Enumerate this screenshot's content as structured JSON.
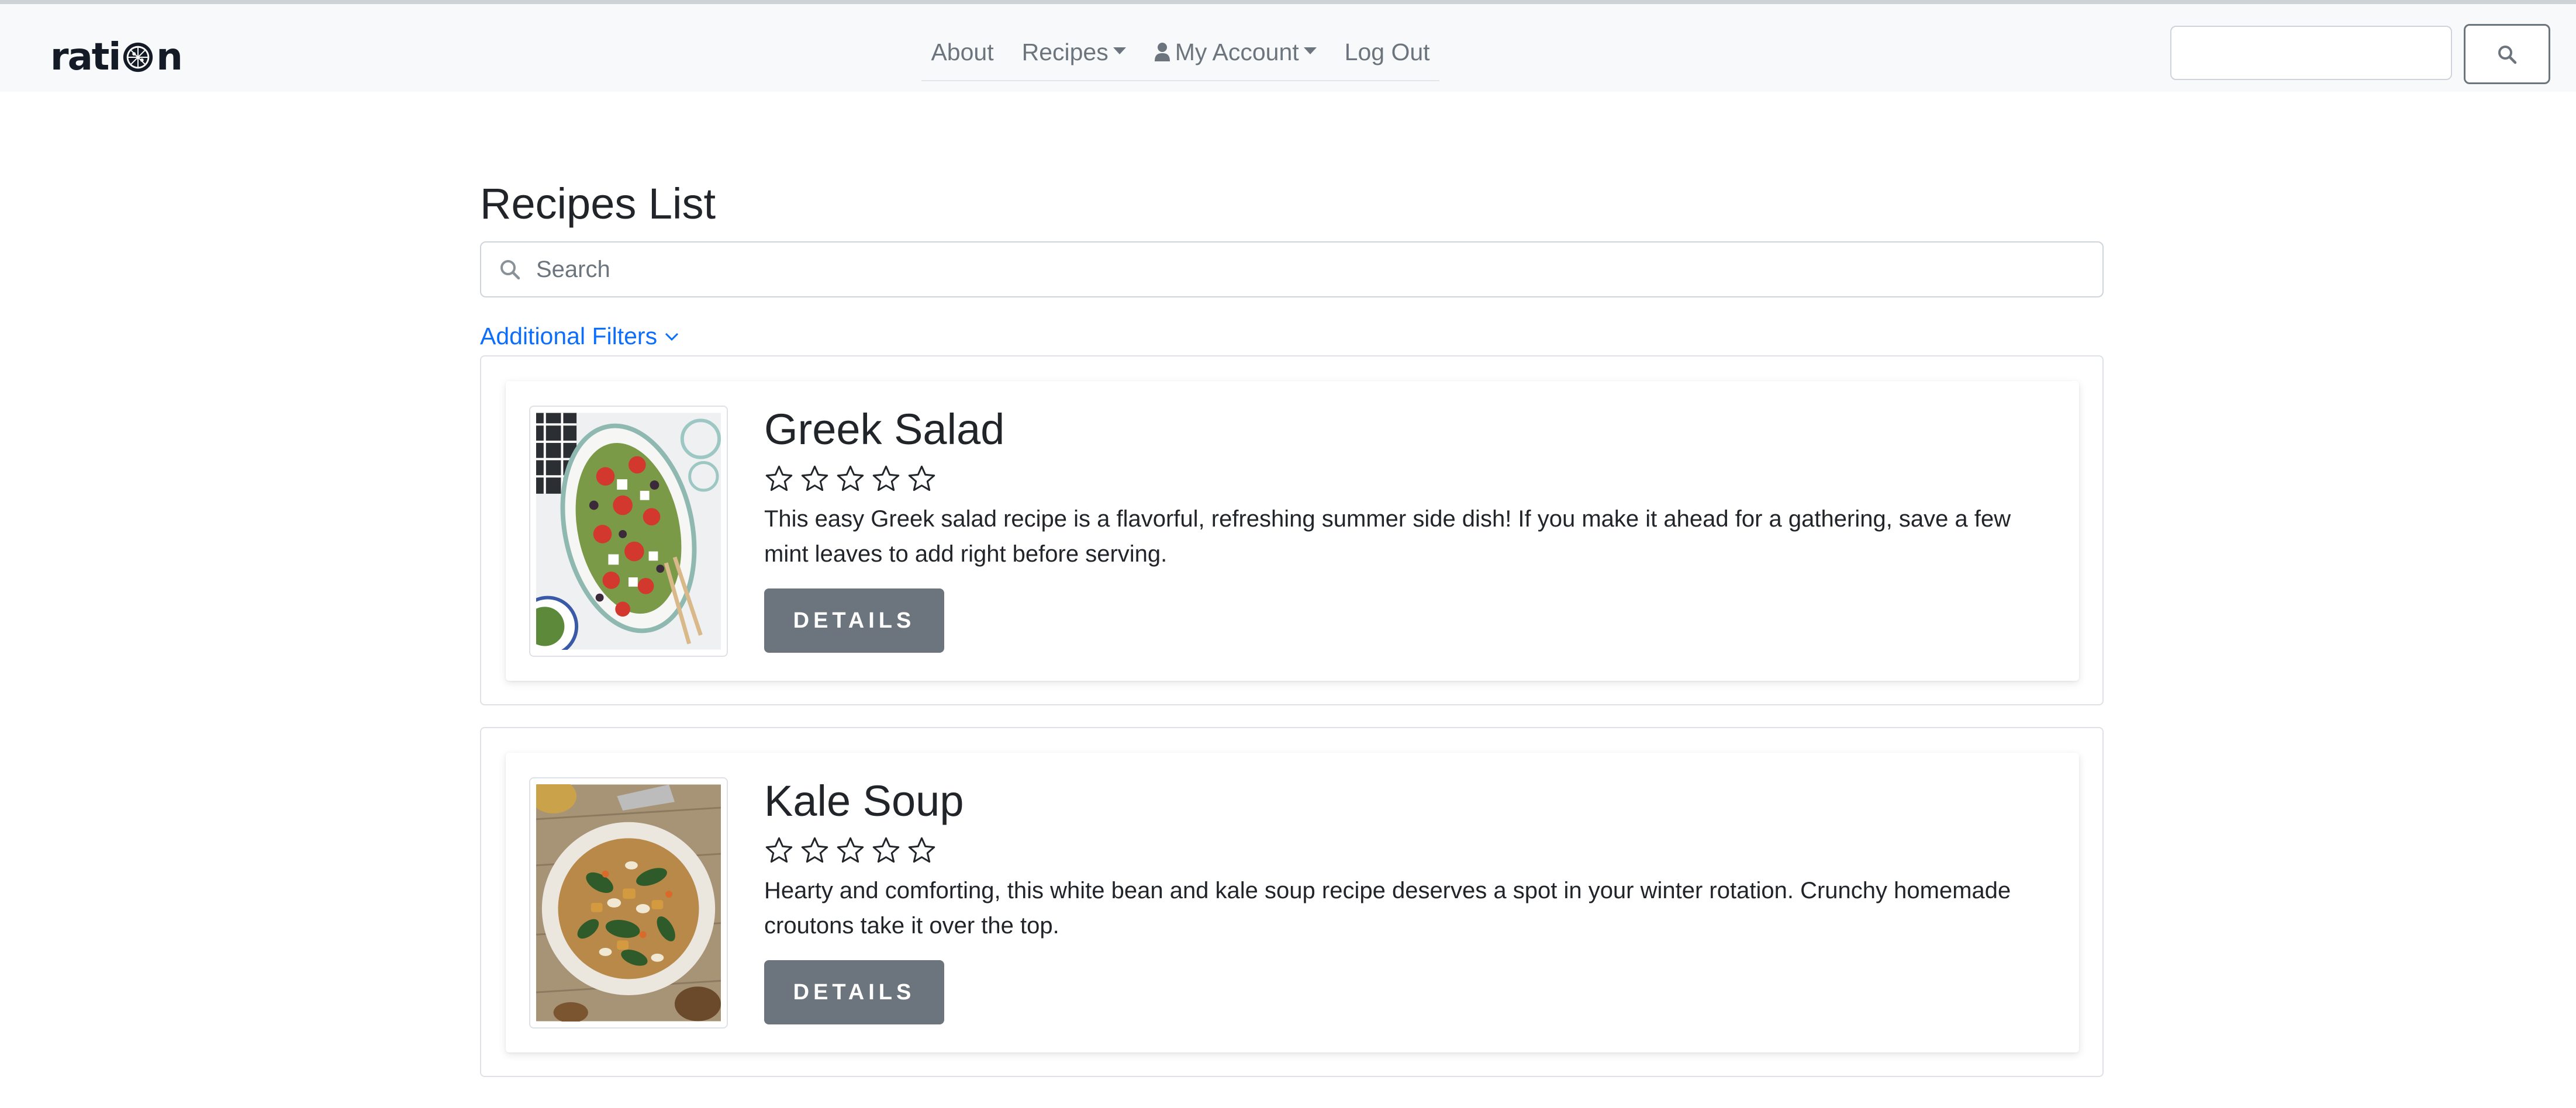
{
  "brand": {
    "logo_text_a": "rati",
    "logo_text_b": "n"
  },
  "nav": {
    "about": "About",
    "recipes": "Recipes",
    "my_account": "My Account",
    "log_out": "Log Out",
    "search_value": ""
  },
  "main": {
    "title": "Recipes List",
    "search_placeholder": "Search",
    "filters_label": "Additional Filters"
  },
  "recipes": [
    {
      "name": "Greek Salad",
      "rating": 0,
      "max_rating": 5,
      "description": "This easy Greek salad recipe is a flavorful, refreshing summer side dish! If you make it ahead for a gathering, save a few mint leaves to add right before serving.",
      "button": "DETAILS"
    },
    {
      "name": "Kale Soup",
      "rating": 0,
      "max_rating": 5,
      "description": "Hearty and comforting, this white bean and kale soup recipe deserves a spot in your winter rotation. Crunchy homemade croutons take it over the top.",
      "button": "DETAILS"
    }
  ],
  "colors": {
    "navbar_bg": "#f8f9fa",
    "link_blue": "#0d6efd",
    "button_gray": "#6c757d",
    "text_dark": "#212529"
  }
}
